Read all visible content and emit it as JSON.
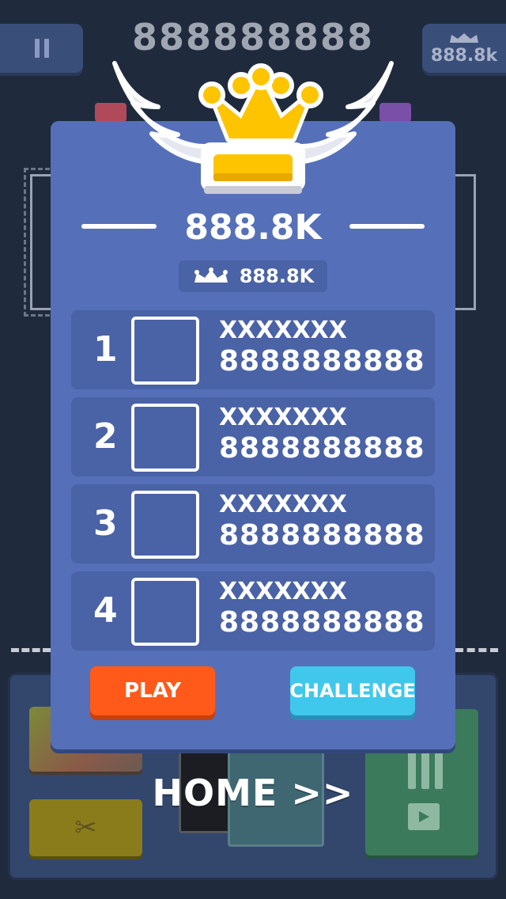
{
  "hud": {
    "score": "888888888",
    "best_score": "888.8k"
  },
  "panel": {
    "score": "888.8K",
    "best_score": "888.8K"
  },
  "leaderboard": [
    {
      "rank": "1",
      "name": "XXXXXXX",
      "score": "8888888888"
    },
    {
      "rank": "2",
      "name": "XXXXXXX",
      "score": "8888888888"
    },
    {
      "rank": "3",
      "name": "XXXXXXX",
      "score": "8888888888"
    },
    {
      "rank": "4",
      "name": "XXXXXXX",
      "score": "8888888888"
    }
  ],
  "buttons": {
    "play": "PLAY",
    "challenge": "CHALLENGE",
    "home": "HOME >>"
  },
  "icons": {
    "pause": "pause-icon",
    "crown": "crown-icon",
    "wings": "wings-icon",
    "scissors": "scissors-icon",
    "video": "video-icon"
  },
  "colors": {
    "background": "#1f2a3d",
    "panel": "#5570b8",
    "row": "#4a62a6",
    "play_button": "#ff5a1a",
    "challenge_button": "#40c8ec",
    "crown": "#ffc400"
  }
}
